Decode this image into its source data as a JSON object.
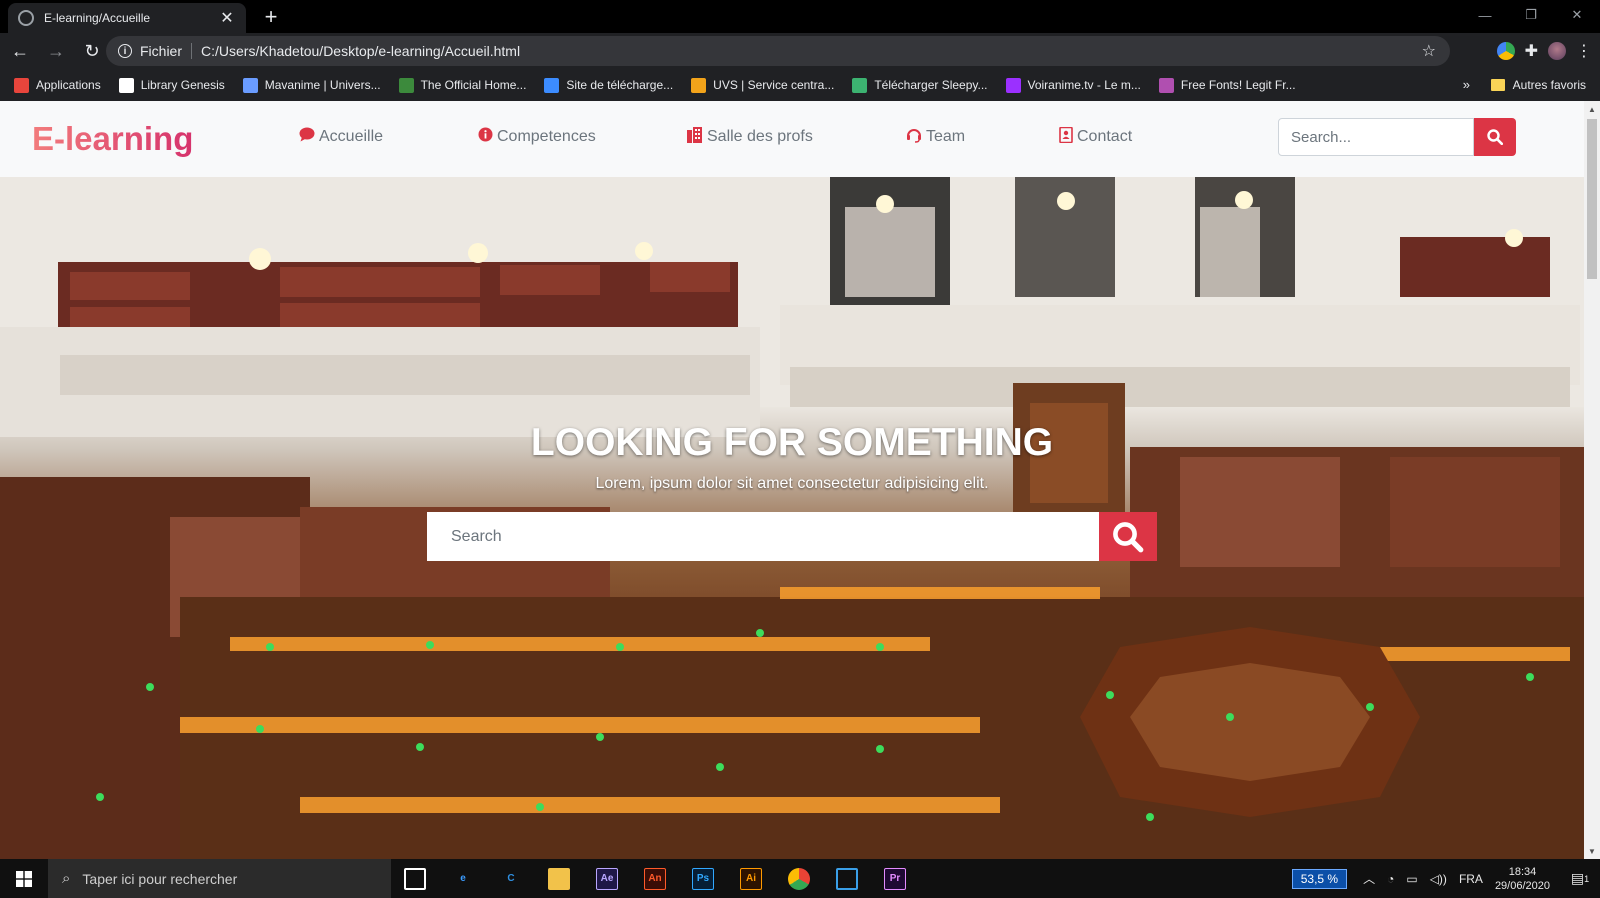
{
  "browser": {
    "tab_title": "E-learning/Accueille",
    "new_tab": "+",
    "url_scheme": "Fichier",
    "url": "C:/Users/Khadetou/Desktop/e-learning/Accueil.html"
  },
  "bookmarks": {
    "items": [
      {
        "label": "Applications",
        "color": "#e8453c"
      },
      {
        "label": "Library Genesis",
        "color": "#ffffff"
      },
      {
        "label": "Mavanime | Univers...",
        "color": "#6a9cff"
      },
      {
        "label": "The Official Home...",
        "color": "#3c8a3c"
      },
      {
        "label": "Site de télécharge...",
        "color": "#3c8cff"
      },
      {
        "label": "UVS | Service centra...",
        "color": "#f2a31a"
      },
      {
        "label": "Télécharger Sleepy...",
        "color": "#3cb371"
      },
      {
        "label": "Voiranime.tv - Le m...",
        "color": "#9b30ff"
      },
      {
        "label": "Free Fonts! Legit Fr...",
        "color": "#b04fb0"
      }
    ],
    "more": "»",
    "other": "Autres favoris"
  },
  "site": {
    "brand": "E-learning",
    "nav": [
      {
        "label": "Accueille",
        "icon": "comment-icon"
      },
      {
        "label": "Competences",
        "icon": "info-circle-icon"
      },
      {
        "label": "Salle des profs",
        "icon": "building-icon"
      },
      {
        "label": "Team",
        "icon": "headset-icon"
      },
      {
        "label": "Contact",
        "icon": "address-card-icon"
      }
    ],
    "search_placeholder": "Search..."
  },
  "hero": {
    "title": "LOOKING FOR SOMETHING",
    "subtitle": "Lorem, ipsum dolor sit amet consectetur adipisicing elit.",
    "search_placeholder": "Search"
  },
  "taskbar": {
    "search_placeholder": "Taper ici pour rechercher",
    "apps": [
      {
        "name": "task-view",
        "label": ""
      },
      {
        "name": "edge",
        "label": "e"
      },
      {
        "name": "ccleaner",
        "label": "C"
      },
      {
        "name": "file-explorer",
        "label": ""
      },
      {
        "name": "after-effects",
        "label": "Ae"
      },
      {
        "name": "animate",
        "label": "An"
      },
      {
        "name": "photoshop",
        "label": "Ps"
      },
      {
        "name": "illustrator",
        "label": "Ai"
      },
      {
        "name": "chrome",
        "label": ""
      },
      {
        "name": "vscode",
        "label": ""
      },
      {
        "name": "premiere",
        "label": "Pr"
      }
    ],
    "zoom": "53,5 %",
    "lang": "FRA",
    "time": "18:34",
    "date": "29/06/2020",
    "notifications": "1"
  },
  "colors": {
    "accent": "#dc3545",
    "brand_from": "#f27c7c",
    "brand_to": "#d6336c"
  }
}
